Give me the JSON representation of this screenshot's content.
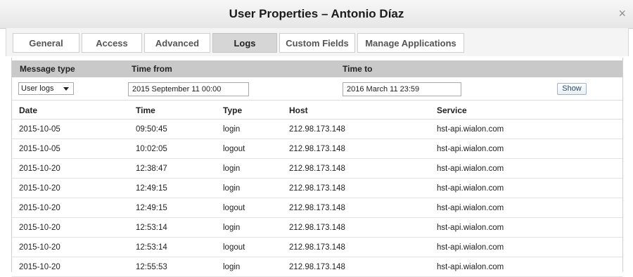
{
  "window": {
    "title": "User Properties – Antonio Díaz",
    "close_symbol": "×"
  },
  "tabs": [
    {
      "label": "General",
      "active": false
    },
    {
      "label": "Access",
      "active": false
    },
    {
      "label": "Advanced",
      "active": false
    },
    {
      "label": "Logs",
      "active": true
    },
    {
      "label": "Custom Fields",
      "active": false
    },
    {
      "label": "Manage Applications",
      "active": false
    }
  ],
  "filters": {
    "message_type_label": "Message type",
    "time_from_label": "Time from",
    "time_to_label": "Time to",
    "message_type_value": "User logs",
    "time_from_value": "2015 September 11 00:00",
    "time_to_value": "2016 March 11 23:59",
    "show_button": "Show"
  },
  "table": {
    "columns": [
      "Date",
      "Time",
      "Type",
      "Host",
      "Service"
    ],
    "rows": [
      [
        "2015-10-05",
        "09:50:45",
        "login",
        "212.98.173.148",
        "hst-api.wialon.com"
      ],
      [
        "2015-10-05",
        "10:02:05",
        "logout",
        "212.98.173.148",
        "hst-api.wialon.com"
      ],
      [
        "2015-10-20",
        "12:38:47",
        "login",
        "212.98.173.148",
        "hst-api.wialon.com"
      ],
      [
        "2015-10-20",
        "12:49:15",
        "login",
        "212.98.173.148",
        "hst-api.wialon.com"
      ],
      [
        "2015-10-20",
        "12:49:15",
        "logout",
        "212.98.173.148",
        "hst-api.wialon.com"
      ],
      [
        "2015-10-20",
        "12:53:14",
        "login",
        "212.98.173.148",
        "hst-api.wialon.com"
      ],
      [
        "2015-10-20",
        "12:53:14",
        "logout",
        "212.98.173.148",
        "hst-api.wialon.com"
      ],
      [
        "2015-10-20",
        "12:55:53",
        "login",
        "212.98.173.148",
        "hst-api.wialon.com"
      ]
    ]
  }
}
